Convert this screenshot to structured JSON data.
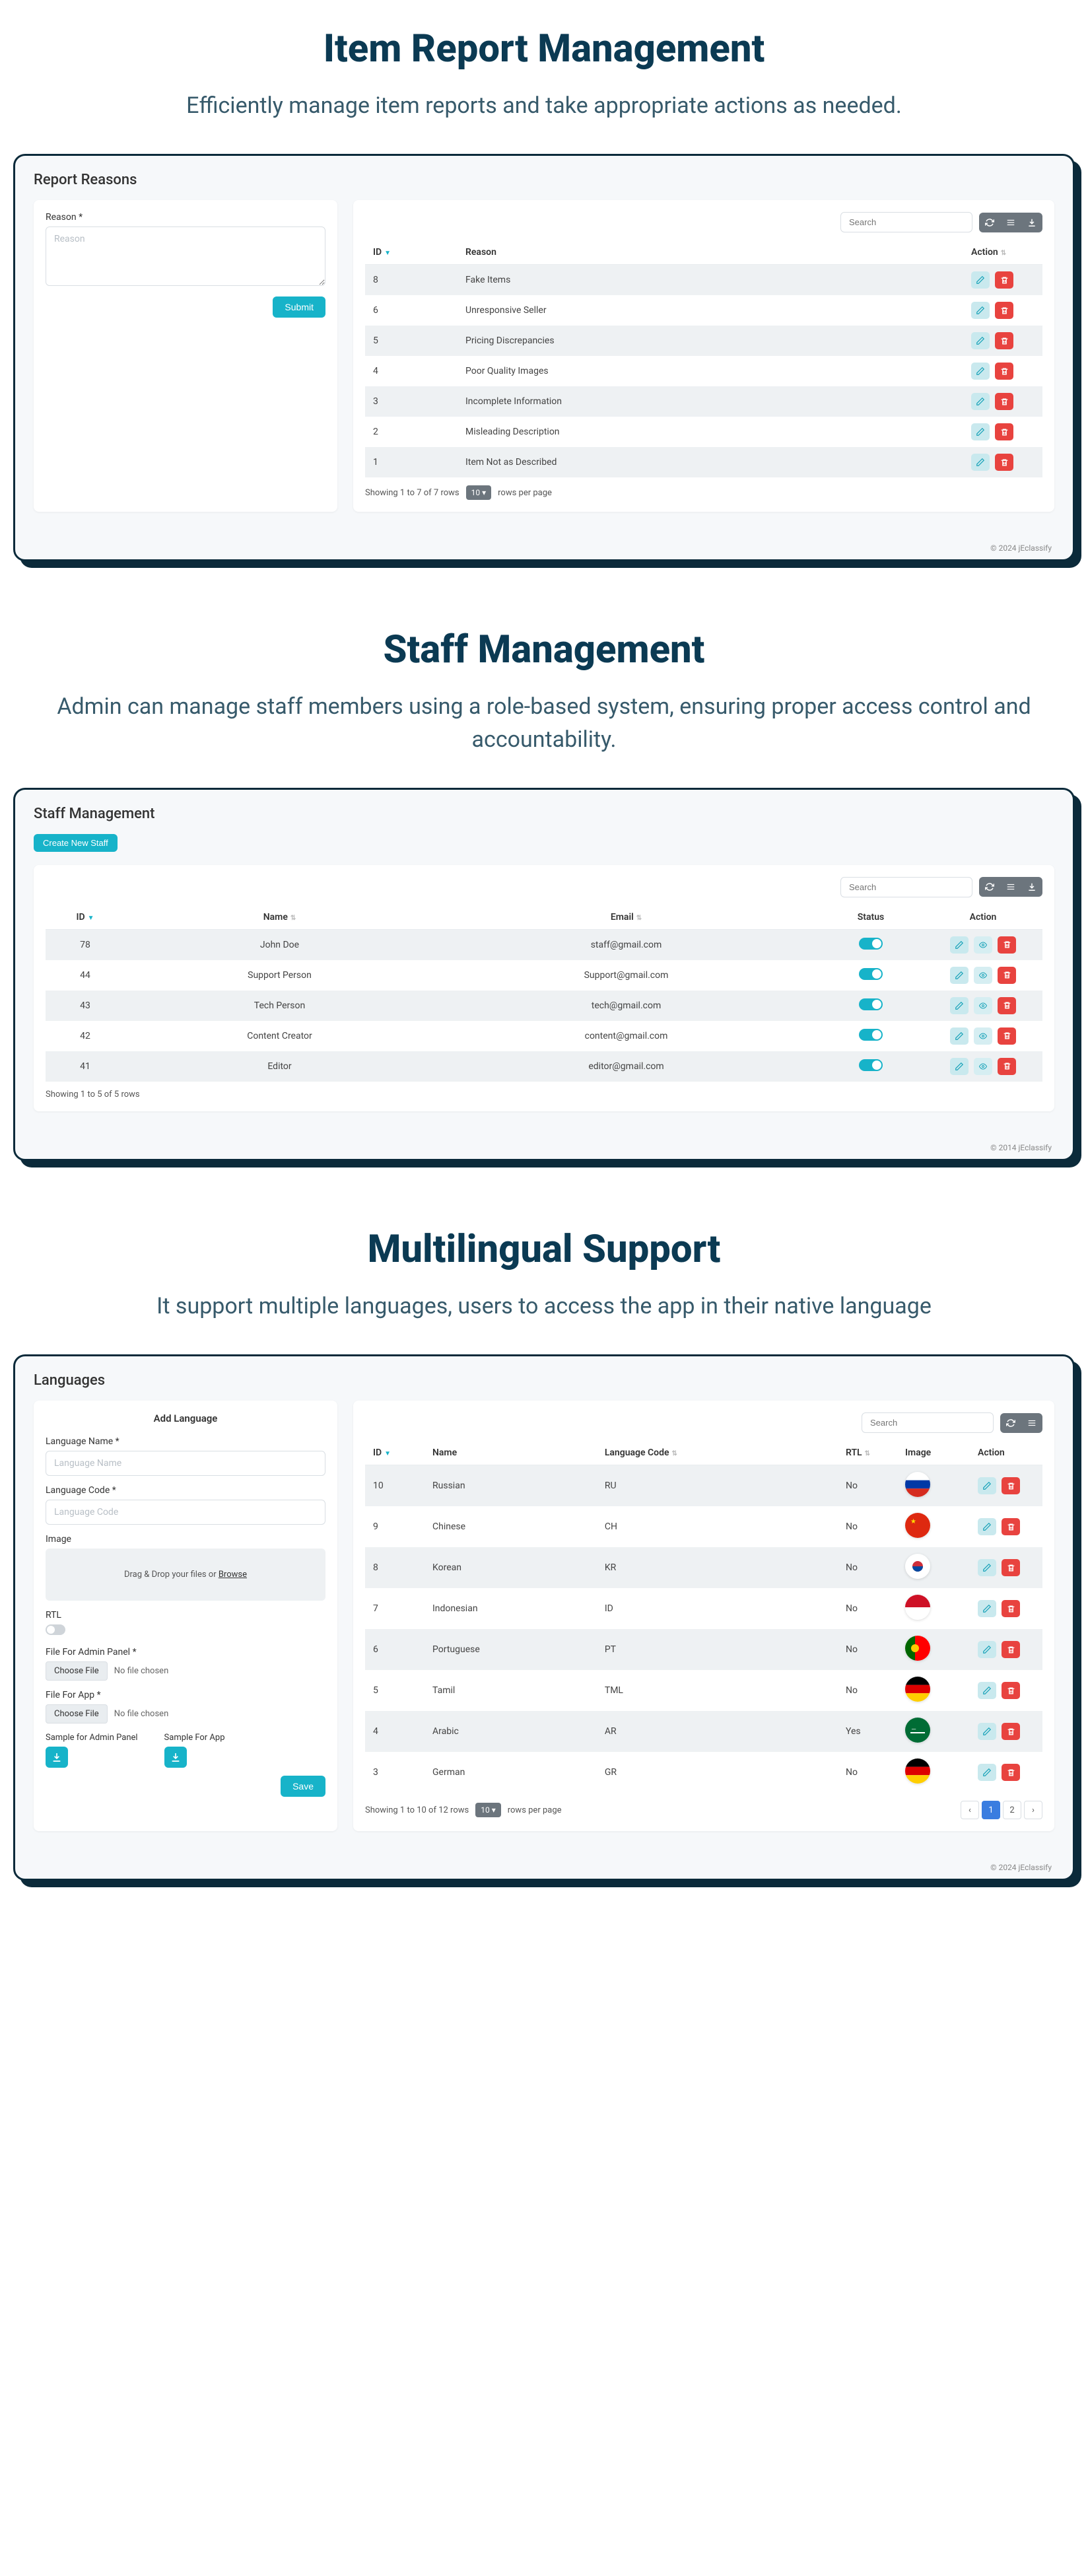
{
  "s1": {
    "title": "Item Report Management",
    "subtitle": "Efficiently manage item reports and take appropriate actions as needed.",
    "panelTitle": "Report Reasons",
    "reasonLabel": "Reason",
    "reasonPlaceholder": "Reason",
    "submit": "Submit",
    "searchPlaceholder": "Search",
    "cols": {
      "id": "ID",
      "reason": "Reason",
      "action": "Action"
    },
    "rows": [
      {
        "id": "8",
        "reason": "Fake Items"
      },
      {
        "id": "6",
        "reason": "Unresponsive Seller"
      },
      {
        "id": "5",
        "reason": "Pricing Discrepancies"
      },
      {
        "id": "4",
        "reason": "Poor Quality Images"
      },
      {
        "id": "3",
        "reason": "Incomplete Information"
      },
      {
        "id": "2",
        "reason": "Misleading Description"
      },
      {
        "id": "1",
        "reason": "Item Not as Described"
      }
    ],
    "pageInfo": "Showing 1 to 7 of 7 rows",
    "perPage": "10",
    "perPageSuffix": "rows per page",
    "footer": "© 2024 jEclassify"
  },
  "s2": {
    "title": "Staff Management",
    "subtitle": "Admin can manage staff members using a role-based system, ensuring proper access control and accountability.",
    "panelTitle": "Staff Management",
    "createBtn": "Create New Staff",
    "searchPlaceholder": "Search",
    "cols": {
      "id": "ID",
      "name": "Name",
      "email": "Email",
      "status": "Status",
      "action": "Action"
    },
    "rows": [
      {
        "id": "78",
        "name": "John Doe",
        "email": "staff@gmail.com"
      },
      {
        "id": "44",
        "name": "Support Person",
        "email": "Support@gmail.com"
      },
      {
        "id": "43",
        "name": "Tech Person",
        "email": "tech@gmail.com"
      },
      {
        "id": "42",
        "name": "Content Creator",
        "email": "content@gmail.com"
      },
      {
        "id": "41",
        "name": "Editor",
        "email": "editor@gmail.com"
      }
    ],
    "pageInfo": "Showing 1 to 5 of 5 rows",
    "footer": "© 2014 jEclassify"
  },
  "s3": {
    "title": "Multilingual Support",
    "subtitle": "It support multiple languages, users to access the app in their native language",
    "panelTitle": "Languages",
    "addHead": "Add Language",
    "langName": "Language Name",
    "langNamePh": "Language Name",
    "langCode": "Language Code",
    "langCodePh": "Language Code",
    "imageLabel": "Image",
    "dropPrefix": "Drag & Drop your files or ",
    "dropLink": "Browse",
    "rtlLabel": "RTL",
    "fileAdmin": "File For Admin Panel",
    "fileApp": "File For App",
    "choose": "Choose File",
    "nofile": "No file chosen",
    "sampleAdmin": "Sample for Admin Panel",
    "sampleApp": "Sample For App",
    "save": "Save",
    "searchPlaceholder": "Search",
    "cols": {
      "id": "ID",
      "name": "Name",
      "code": "Language Code",
      "rtl": "RTL",
      "image": "Image",
      "action": "Action"
    },
    "rows": [
      {
        "id": "10",
        "name": "Russian",
        "code": "RU",
        "rtl": "No",
        "flag": "ru"
      },
      {
        "id": "9",
        "name": "Chinese",
        "code": "CH",
        "rtl": "No",
        "flag": "cn"
      },
      {
        "id": "8",
        "name": "Korean",
        "code": "KR",
        "rtl": "No",
        "flag": "kr"
      },
      {
        "id": "7",
        "name": "Indonesian",
        "code": "ID",
        "rtl": "No",
        "flag": "id"
      },
      {
        "id": "6",
        "name": "Portuguese",
        "code": "PT",
        "rtl": "No",
        "flag": "pt"
      },
      {
        "id": "5",
        "name": "Tamil",
        "code": "TML",
        "rtl": "No",
        "flag": "de2"
      },
      {
        "id": "4",
        "name": "Arabic",
        "code": "AR",
        "rtl": "Yes",
        "flag": "sa"
      },
      {
        "id": "3",
        "name": "German",
        "code": "GR",
        "rtl": "No",
        "flag": "de"
      }
    ],
    "pageInfo": "Showing 1 to 10 of 12 rows",
    "perPage": "10",
    "perPageSuffix": "rows per page",
    "pages": [
      "1",
      "2"
    ],
    "footer": "© 2024 jEclassify"
  }
}
